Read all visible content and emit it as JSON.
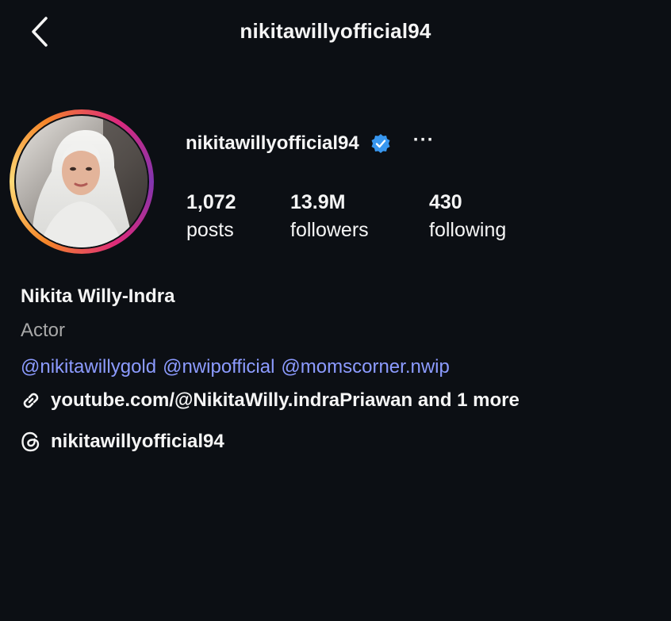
{
  "header": {
    "title": "nikitawillyofficial94",
    "back_icon": "chevron-left-icon"
  },
  "profile": {
    "username": "nikitawillyofficial94",
    "verified_icon": "verified-badge-icon",
    "more_icon": "more-horizontal-icon",
    "more_label": "···",
    "stats": {
      "posts": {
        "value": "1,072",
        "label": "posts"
      },
      "followers": {
        "value": "13.9M",
        "label": "followers"
      },
      "following": {
        "value": "430",
        "label": "following"
      }
    },
    "full_name": "Nikita Willy-Indra",
    "category": "Actor",
    "mentions": [
      "@nikitawillygold",
      "@nwipofficial",
      "@momscorner.nwip"
    ],
    "link": {
      "icon": "link-icon",
      "text": "youtube.com/@NikitaWilly.indraPriawan and 1 more"
    },
    "threads": {
      "icon": "threads-icon",
      "text": "nikitawillyofficial94"
    }
  },
  "colors": {
    "background": "#0c0f14",
    "text": "#f5f5f5",
    "muted": "#a8a8a8",
    "mention": "#8c9bff",
    "verified": "#3897f0"
  }
}
